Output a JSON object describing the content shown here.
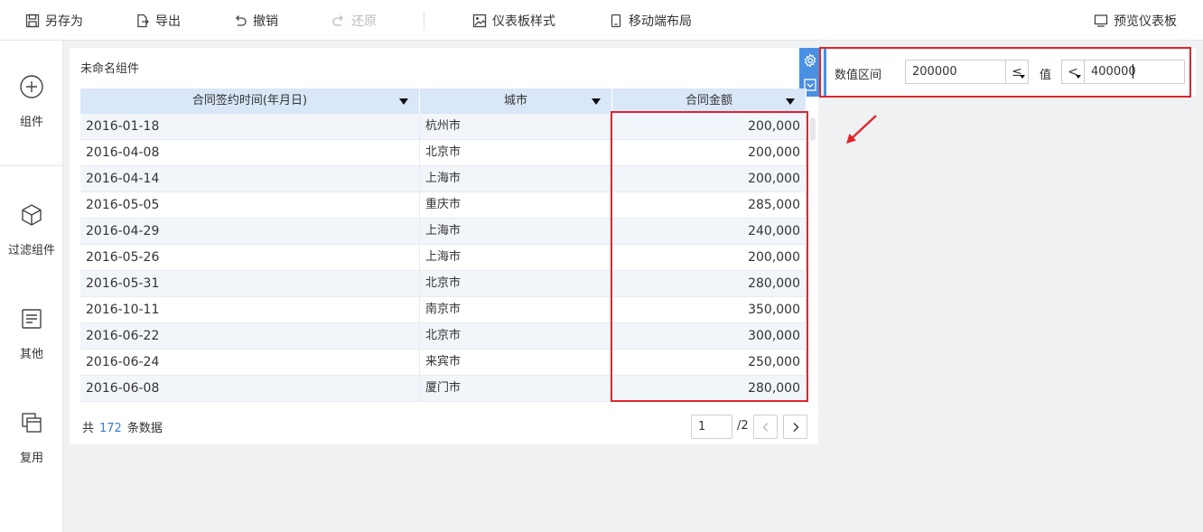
{
  "toolbar": {
    "save_as": "另存为",
    "export": "导出",
    "undo": "撤销",
    "redo": "还原",
    "dashboard_style": "仪表板样式",
    "mobile_layout": "移动端布局",
    "preview": "预览仪表板"
  },
  "leftnav": {
    "component": "组件",
    "filter_component": "过滤组件",
    "other": "其他",
    "reuse": "复用"
  },
  "widget": {
    "title": "未命名组件",
    "columns": [
      "合同签约时间(年月日)",
      "城市",
      "合同金额"
    ],
    "rows": [
      [
        "2016-01-18",
        "杭州市",
        "200,000"
      ],
      [
        "2016-04-08",
        "北京市",
        "200,000"
      ],
      [
        "2016-04-14",
        "上海市",
        "200,000"
      ],
      [
        "2016-05-05",
        "重庆市",
        "285,000"
      ],
      [
        "2016-04-29",
        "上海市",
        "240,000"
      ],
      [
        "2016-05-26",
        "上海市",
        "200,000"
      ],
      [
        "2016-05-31",
        "北京市",
        "280,000"
      ],
      [
        "2016-10-11",
        "南京市",
        "350,000"
      ],
      [
        "2016-06-22",
        "北京市",
        "300,000"
      ],
      [
        "2016-06-24",
        "来宾市",
        "250,000"
      ],
      [
        "2016-06-08",
        "厦门市",
        "280,000"
      ]
    ],
    "footer": {
      "prefix": "共",
      "count": "172",
      "suffix": "条数据",
      "page": "1",
      "total_pages": "/2"
    }
  },
  "filter": {
    "label": "数值区间",
    "min_value": "200000",
    "min_op": "≤",
    "value_label": "值",
    "max_op": "<",
    "max_value": "400000"
  },
  "colors": {
    "accent": "#4a90e2",
    "highlight": "#e0262b",
    "header_bg": "#d9e7f8"
  }
}
